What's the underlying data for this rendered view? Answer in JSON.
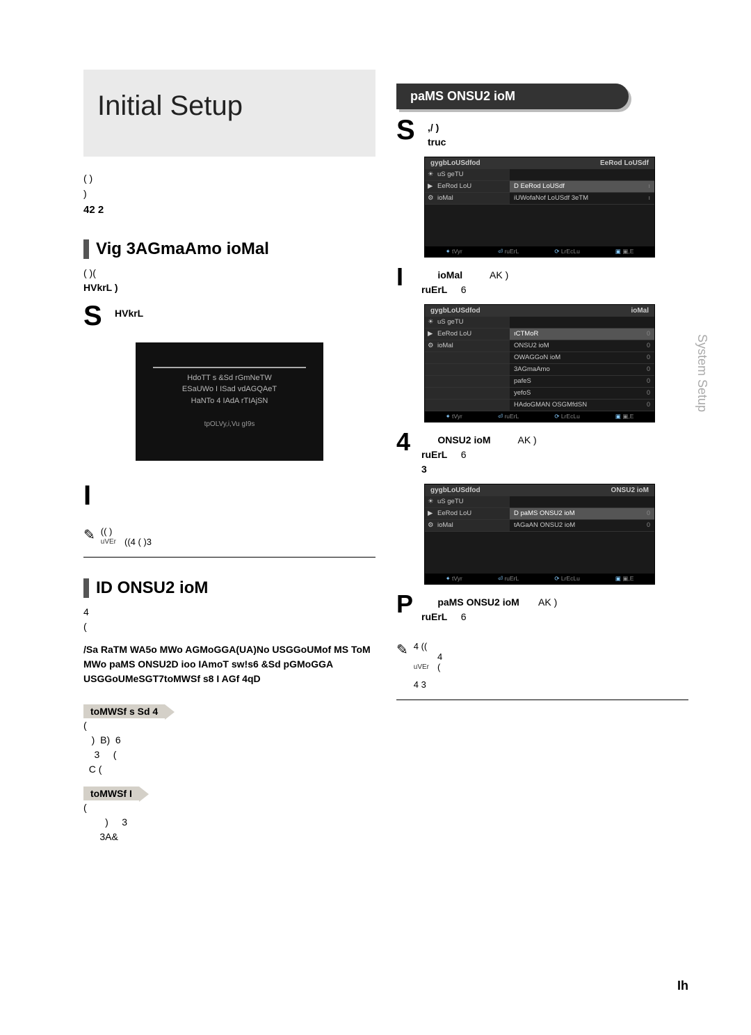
{
  "header": {
    "title": "Initial Setup"
  },
  "left": {
    "intro1": "(       )",
    "intro2": "        )",
    "intro3": "42 2",
    "sec1_title": "Vig 3AGmaAmo ioMal",
    "sec1_p1": "(       )(",
    "sec1_p2": "HVkrL      )",
    "step_s_num": "S",
    "step_s_text": "HVkrL",
    "tv_l1": "HdoTT s &Sd rGmNeTW",
    "tv_l2": "ESaUWo I ISad vdAGQAeT",
    "tv_l3": "HaNTo 4 IAdA rTIAjSN",
    "tv_ok": "tpOLVy,i,Vu gI9s",
    "step_i_num": "I",
    "note1_body": "((        )",
    "note1_body2": "((4 (   )3",
    "note_lbl": "uVEr",
    "sec2_title": "ID  ONSU2 ioM",
    "sec2_p1": "4",
    "sec2_p2": "(",
    "bold_block": "/Sa RaTM WA5o MWo AGMoGGA(UA)No USGGoUMof MS ToM MWo paMS ONSU2D ioo IAmoT sw!s6 &Sd pGMoGGA USGGoUMeSGT7toMWSf s8 I AGf 4qD",
    "caution1": "toMWSf s Sd 4",
    "c1_body": "(\n   )  B)  6\n    3     (\n  C (",
    "caution2": "toMWSf I",
    "c2_body": "(\n        )     3\n      3A&"
  },
  "right": {
    "pill": "paMS ONSU2 ioM",
    "rs_num": "S",
    "rs_t1": ",/ )",
    "rs_t2": "truc",
    "menu1": {
      "title_l": "gygbLoUSdfod",
      "title_r": "EeRod LoUSdf",
      "rows": [
        {
          "left": "uS geTU",
          "right": "",
          "val": ""
        },
        {
          "left": "EeRod LoU",
          "right": "D EeRod LoUSdf",
          "val": "ı",
          "hl": true
        },
        {
          "left": "ioMal",
          "right": "iUWofaNof LoUSdf 3eTM",
          "val": "ı"
        }
      ]
    },
    "ri_num": "I",
    "ri_t1": "ioMal",
    "ri_t1b": "AK  )",
    "ri_t2": "ruErL",
    "ri_t2b": "6",
    "menu2": {
      "title_l": "gygbLoUSdfod",
      "title_r": "ioMal",
      "rows": [
        {
          "left": "uS geTU",
          "right": "",
          "val": ""
        },
        {
          "left": "EeRod LoU",
          "right": "ıCTMoR",
          "val": "0",
          "hl": true
        },
        {
          "left": "ioMal",
          "right": "ONSU2 ioM",
          "val": "0"
        },
        {
          "left": "",
          "right": "OWAGGoN ioM",
          "val": "0"
        },
        {
          "left": "",
          "right": "3AGmaAmo",
          "val": "0"
        },
        {
          "left": "",
          "right": "pafeS",
          "val": "0"
        },
        {
          "left": "",
          "right": "yefoS",
          "val": "0"
        },
        {
          "left": "",
          "right": "HAdoGMAN OSGMfdSN",
          "val": "0"
        }
      ]
    },
    "r4_num": "4",
    "r4_t1": "ONSU2 ioM",
    "r4_t1b": "AK   )",
    "r4_t2": "ruErL",
    "r4_t2b": "6",
    "r4_t3": "3",
    "menu3": {
      "title_l": "gygbLoUSdfod",
      "title_r": "ONSU2 ioM",
      "rows": [
        {
          "left": "uS geTU",
          "right": "",
          "val": ""
        },
        {
          "left": "EeRod LoU",
          "right": "D paMS ONSU2 ioM",
          "val": "0",
          "hl": true
        },
        {
          "left": "ioMal",
          "right": "tAGaAN ONSU2 ioM",
          "val": "0"
        }
      ]
    },
    "rp_num": "P",
    "rp_t1": "paMS ONSU2 ioM",
    "rp_t1b": "AK   )",
    "rp_t2": "ruErL",
    "rp_t2b": "6",
    "note2_a": "4 ((",
    "note2_b": "4",
    "note2_c": "(",
    "note2_d": "4      3",
    "footer": {
      "mv": "tVyr",
      "en": "ruErL",
      "rt": "LrEcLu",
      "ex": "▣,E"
    }
  },
  "side_tab": "System Setup",
  "page_num": "Ih"
}
